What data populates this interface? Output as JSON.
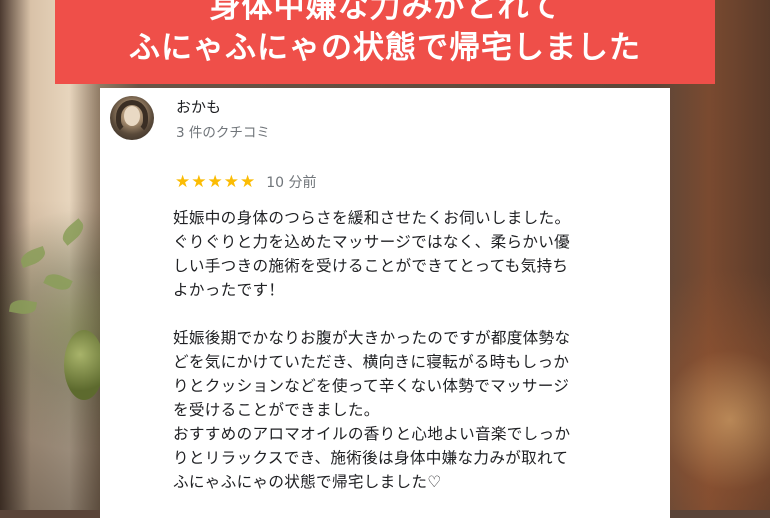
{
  "banner": {
    "line1": "身体中嫌な力みがとれて",
    "line2": "ふにゃふにゃの状態で帰宅しました"
  },
  "review": {
    "author": "おかも",
    "review_count": "3 件のクチコミ",
    "stars": "★★★★★",
    "rating_value": 5,
    "time": "10 分前",
    "paragraph1": [
      "妊娠中の身体のつらさを緩和させたくお伺いしました。",
      "ぐりぐりと力を込めたマッサージではなく、柔らかい優",
      "しい手つきの施術を受けることができてとっても気持ち",
      "よかったです！"
    ],
    "paragraph2": [
      "妊娠後期でかなりお腹が大きかったのですが都度体勢な",
      "どを気にかけていただき、横向きに寝転がる時もしっか",
      "りとクッションなどを使って辛くない体勢でマッサージ",
      "を受けることができました。",
      "おすすめのアロマオイルの香りと心地よい音楽でしっか",
      "りとリラックスでき、施術後は身体中嫌な力みが取れて",
      "ふにゃふにゃの状態で帰宅しました♡"
    ]
  },
  "colors": {
    "banner": "#ef4f49",
    "star": "#fbbc04",
    "muted": "#70757a"
  }
}
